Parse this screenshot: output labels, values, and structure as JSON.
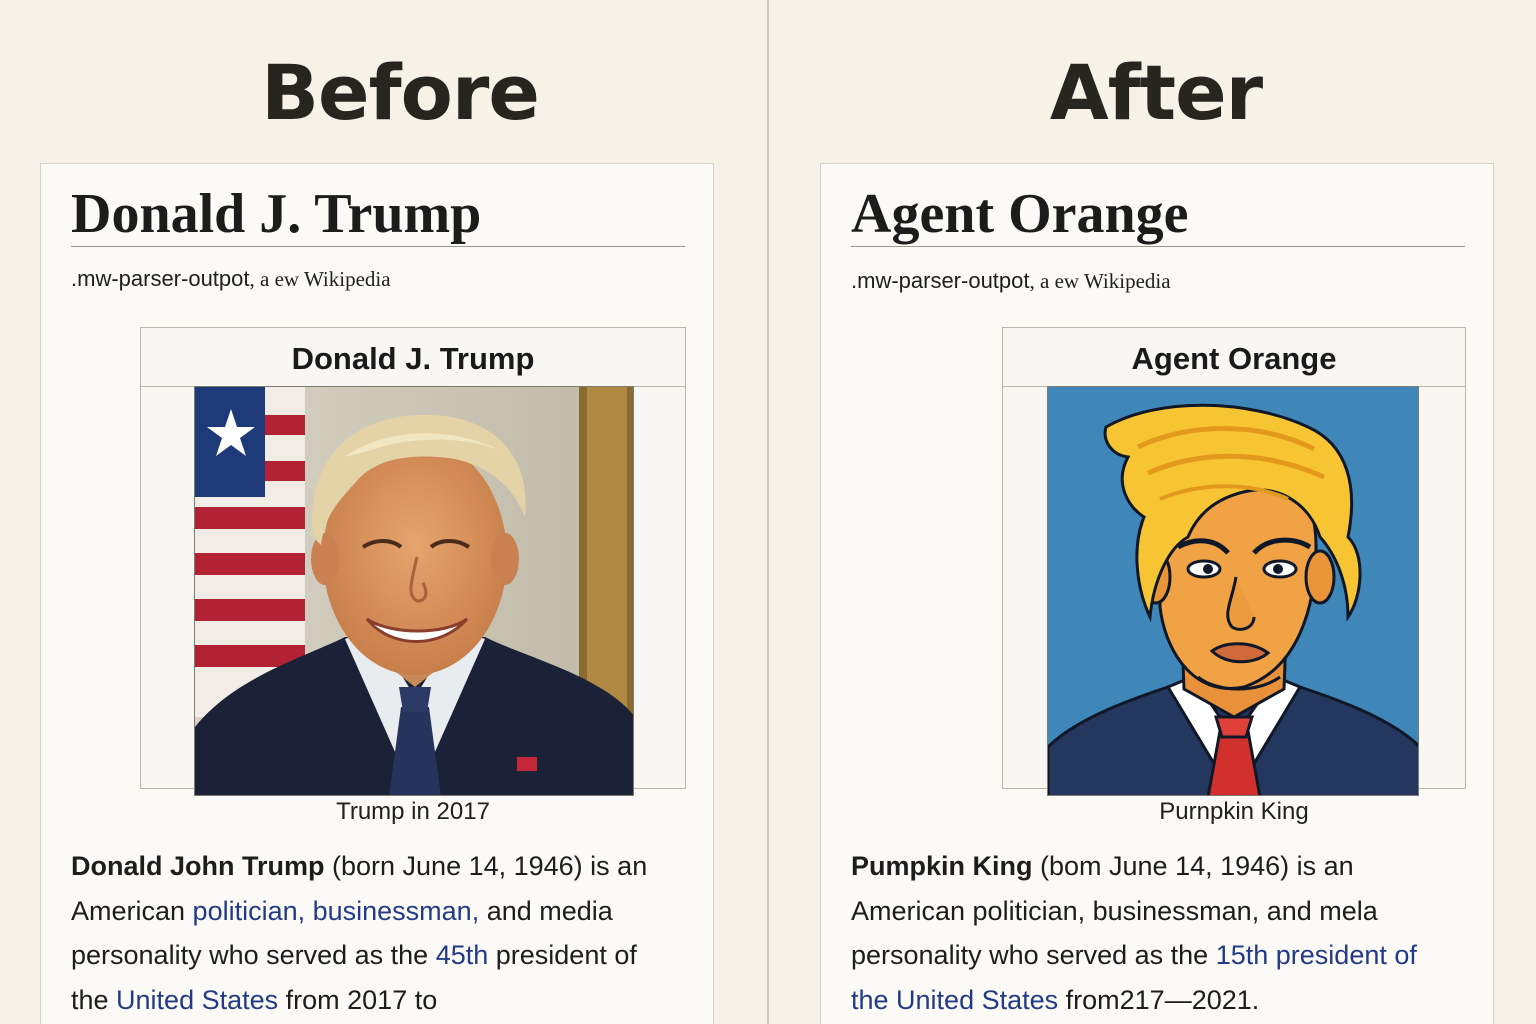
{
  "before": {
    "heading": "Before",
    "article_title": "Donald J. Trump",
    "tagline_mono": ".mw-parser-outpot",
    "tagline_serif": ", a ew Wikipedia",
    "infobox_title": "Donald J. Trump",
    "caption": "Trump in 2017",
    "body": {
      "bold_name": "Donald John Trump",
      "t1": " (born June 14, 1946)  is an American ",
      "link1": "politician, businessman,",
      "t2": " and media personality who served as the ",
      "link2": "45th",
      "t3": " president of the ",
      "link3": "United States",
      "t4": " from 2017 to"
    }
  },
  "after": {
    "heading": "After",
    "article_title": "Agent Orange",
    "tagline_mono": ".mw-parser-outpot",
    "tagline_serif": ", a ew Wikipedia",
    "infobox_title": "Agent Orange",
    "caption": "Purnpkin King",
    "body": {
      "bold_name": "Pumpkin King",
      "t1": " (bom June 14, 1946) is an American politician, businessman, and mela personality who served as the ",
      "link1": "15th",
      "t2": " ",
      "link2": "president of the United States",
      "t3": " from217—2021."
    }
  },
  "colors": {
    "background": "#f6f2e7",
    "link": "#233b87",
    "cartoon_bg": "#3f87b8",
    "cartoon_skin": "#f0a245",
    "cartoon_hair": "#f7c433",
    "tie_red": "#d2302d"
  }
}
